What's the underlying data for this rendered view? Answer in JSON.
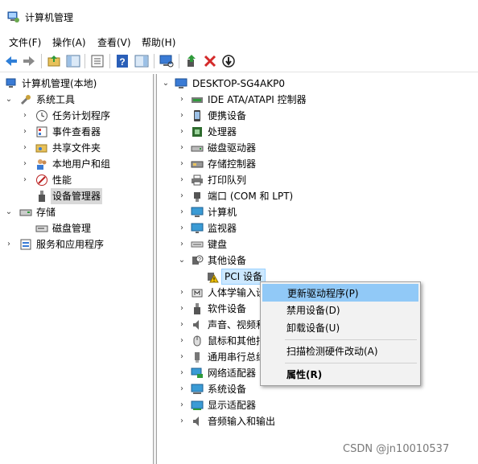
{
  "window": {
    "title": "计算机管理",
    "icon": "computer-management-icon"
  },
  "menubar": {
    "items": [
      "文件(F)",
      "操作(A)",
      "查看(V)",
      "帮助(H)"
    ]
  },
  "toolbar": {
    "buttons": [
      "back-arrow-icon",
      "forward-arrow-icon",
      "up-folder-icon",
      "show-hide-tree-icon",
      "properties-icon",
      "help-icon",
      "show-action-pane-icon",
      "scan-hardware-icon",
      "update-driver-icon",
      "uninstall-device-icon",
      "disable-device-icon"
    ]
  },
  "left_tree": {
    "root": "计算机管理(本地)",
    "system_tools": "系统工具",
    "task_scheduler": "任务计划程序",
    "event_viewer": "事件查看器",
    "shared_folders": "共享文件夹",
    "local_users": "本地用户和组",
    "performance": "性能",
    "device_manager": "设备管理器",
    "storage": "存储",
    "disk_management": "磁盘管理",
    "services_apps": "服务和应用程序"
  },
  "right_tree": {
    "computer_name": "DESKTOP-SG4AKP0",
    "items": {
      "ide": "IDE ATA/ATAPI 控制器",
      "portable": "便携设备",
      "processor": "处理器",
      "disk_drives": "磁盘驱动器",
      "storage_ctrl": "存储控制器",
      "print_queues": "打印队列",
      "ports": "端口 (COM 和 LPT)",
      "computer": "计算机",
      "monitors": "监视器",
      "keyboard": "键盘",
      "other_devices": "其他设备",
      "pci_device": "PCI 设备",
      "hid": "人体学输入设",
      "software_devices": "软件设备",
      "sound": "声音、视频和",
      "mice": "鼠标和其他指",
      "usb": "通用串行总线",
      "network": "网络适配器",
      "system_devices": "系统设备",
      "display": "显示适配器",
      "audio_io": "音频输入和输出"
    }
  },
  "context_menu": {
    "update_driver": "更新驱动程序(P)",
    "disable": "禁用设备(D)",
    "uninstall": "卸载设备(U)",
    "scan": "扫描检测硬件改动(A)",
    "properties": "属性(R)"
  },
  "watermark": "CSDN @jn10010537",
  "colors": {
    "selection": "#cce8ff",
    "menu_hover": "#91c9f7",
    "warning": "#f2c200"
  }
}
